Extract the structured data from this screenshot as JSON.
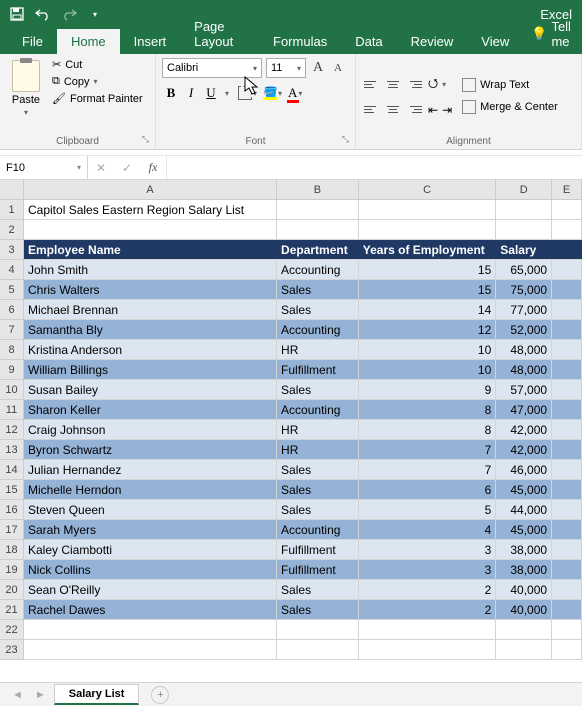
{
  "app_title": "Excel",
  "ribbon": {
    "tabs": [
      "File",
      "Home",
      "Insert",
      "Page Layout",
      "Formulas",
      "Data",
      "Review",
      "View"
    ],
    "active_tab": "Home",
    "tell_me": "Tell me",
    "clipboard": {
      "paste": "Paste",
      "cut": "Cut",
      "copy": "Copy",
      "format_painter": "Format Painter",
      "group": "Clipboard"
    },
    "font": {
      "name": "Calibri",
      "size": "11",
      "group": "Font"
    },
    "alignment": {
      "wrap": "Wrap Text",
      "merge": "Merge & Center",
      "group": "Alignment"
    }
  },
  "formulabar": {
    "cell_ref": "F10",
    "formula": ""
  },
  "sheet": {
    "columns": [
      "A",
      "B",
      "C",
      "D",
      "E"
    ],
    "title_row": "Capitol Sales Eastern Region Salary List",
    "headers": [
      "Employee Name",
      "Department",
      "Years of Employment",
      "Salary"
    ],
    "rows": [
      {
        "name": "John Smith",
        "dept": "Accounting",
        "years": "15",
        "salary": "65,000"
      },
      {
        "name": "Chris Walters",
        "dept": "Sales",
        "years": "15",
        "salary": "75,000"
      },
      {
        "name": "Michael Brennan",
        "dept": "Sales",
        "years": "14",
        "salary": "77,000"
      },
      {
        "name": "Samantha Bly",
        "dept": "Accounting",
        "years": "12",
        "salary": "52,000"
      },
      {
        "name": "Kristina Anderson",
        "dept": "HR",
        "years": "10",
        "salary": "48,000"
      },
      {
        "name": "William Billings",
        "dept": "Fulfillment",
        "years": "10",
        "salary": "48,000"
      },
      {
        "name": "Susan Bailey",
        "dept": "Sales",
        "years": "9",
        "salary": "57,000"
      },
      {
        "name": "Sharon Keller",
        "dept": "Accounting",
        "years": "8",
        "salary": "47,000"
      },
      {
        "name": "Craig Johnson",
        "dept": "HR",
        "years": "8",
        "salary": "42,000"
      },
      {
        "name": "Byron Schwartz",
        "dept": "HR",
        "years": "7",
        "salary": "42,000"
      },
      {
        "name": "Julian Hernandez",
        "dept": "Sales",
        "years": "7",
        "salary": "46,000"
      },
      {
        "name": "Michelle Herndon",
        "dept": "Sales",
        "years": "6",
        "salary": "45,000"
      },
      {
        "name": "Steven Queen",
        "dept": "Sales",
        "years": "5",
        "salary": "44,000"
      },
      {
        "name": "Sarah Myers",
        "dept": "Accounting",
        "years": "4",
        "salary": "45,000"
      },
      {
        "name": "Kaley Ciambotti",
        "dept": "Fulfillment",
        "years": "3",
        "salary": "38,000"
      },
      {
        "name": "Nick Collins",
        "dept": "Fulfillment",
        "years": "3",
        "salary": "38,000"
      },
      {
        "name": "Sean O'Reilly",
        "dept": "Sales",
        "years": "2",
        "salary": "40,000"
      },
      {
        "name": "Rachel Dawes",
        "dept": "Sales",
        "years": "2",
        "salary": "40,000"
      }
    ],
    "tab_name": "Salary List"
  }
}
